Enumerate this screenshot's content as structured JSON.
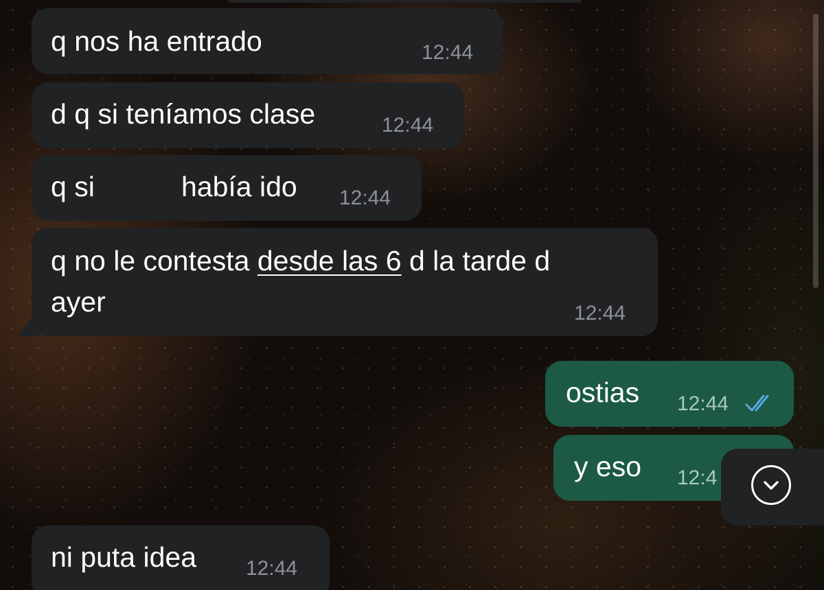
{
  "messages": [
    {
      "direction": "incoming",
      "text": "q nos ha entrado",
      "time": "12:44"
    },
    {
      "direction": "incoming",
      "text": "d q si teníamos clase",
      "time": "12:44"
    },
    {
      "direction": "incoming",
      "text_before": "q si",
      "text_after": "había ido",
      "time": "12:44"
    },
    {
      "direction": "incoming",
      "text_line1_start": "q no le contesta ",
      "text_line1_link": "desde las 6",
      "text_line1_end": " d la tarde d",
      "text_line2": "ayer",
      "time": "12:44"
    },
    {
      "direction": "outgoing",
      "text": "ostias",
      "time": "12:44",
      "status": "read"
    },
    {
      "direction": "outgoing",
      "text": "y eso",
      "time": "12:4",
      "status": "read"
    },
    {
      "direction": "incoming",
      "text": "ni puta idea",
      "time": "12:44"
    }
  ],
  "icons": {
    "read_receipt": "double-check-icon",
    "scroll_down": "chevron-down-circle-icon"
  },
  "colors": {
    "incoming_bubble": "#212224",
    "outgoing_bubble": "#1c5a45",
    "read_receipt": "#5aa9e6",
    "timestamp": "#8e9297"
  }
}
